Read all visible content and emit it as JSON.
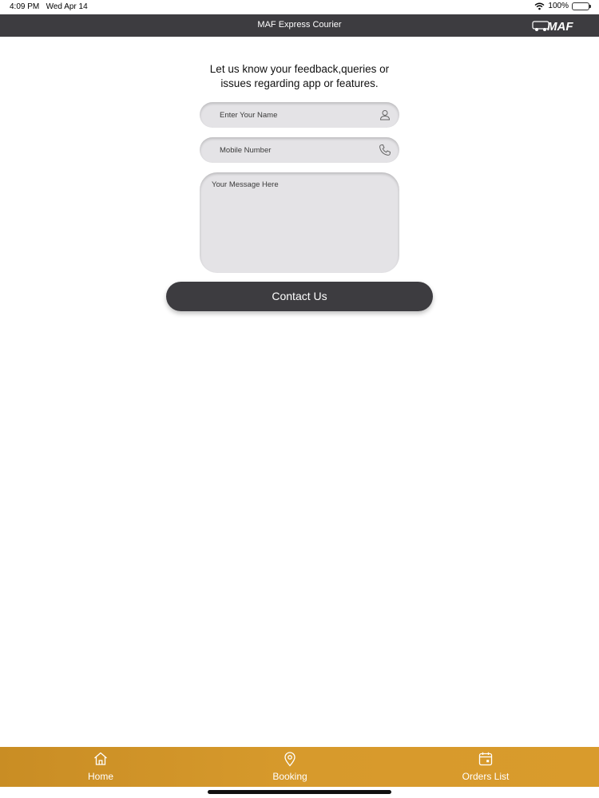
{
  "status_bar": {
    "time": "4:09 PM",
    "date": "Wed Apr 14",
    "battery": "100%",
    "icons": [
      "wifi-icon",
      "battery-icon"
    ]
  },
  "nav": {
    "title": "MAF Express Courier",
    "logo_text": "MAF"
  },
  "form": {
    "intro_line1": "Let us know your feedback,queries or",
    "intro_line2": "issues regarding app or features.",
    "name_placeholder": "Enter Your Name",
    "mobile_placeholder": "Mobile Number",
    "message_placeholder": "Your Message Here",
    "submit_label": "Contact Us"
  },
  "tabs": [
    {
      "label": "Home",
      "icon": "home-icon"
    },
    {
      "label": "Booking",
      "icon": "location-pin-icon"
    },
    {
      "label": "Orders List",
      "icon": "calendar-icon"
    }
  ],
  "colors": {
    "nav_bg": "#3d3c40",
    "tab_bar_bg": "#d79a2c",
    "field_bg": "#e4e3e6",
    "button_bg": "#3d3c40"
  }
}
